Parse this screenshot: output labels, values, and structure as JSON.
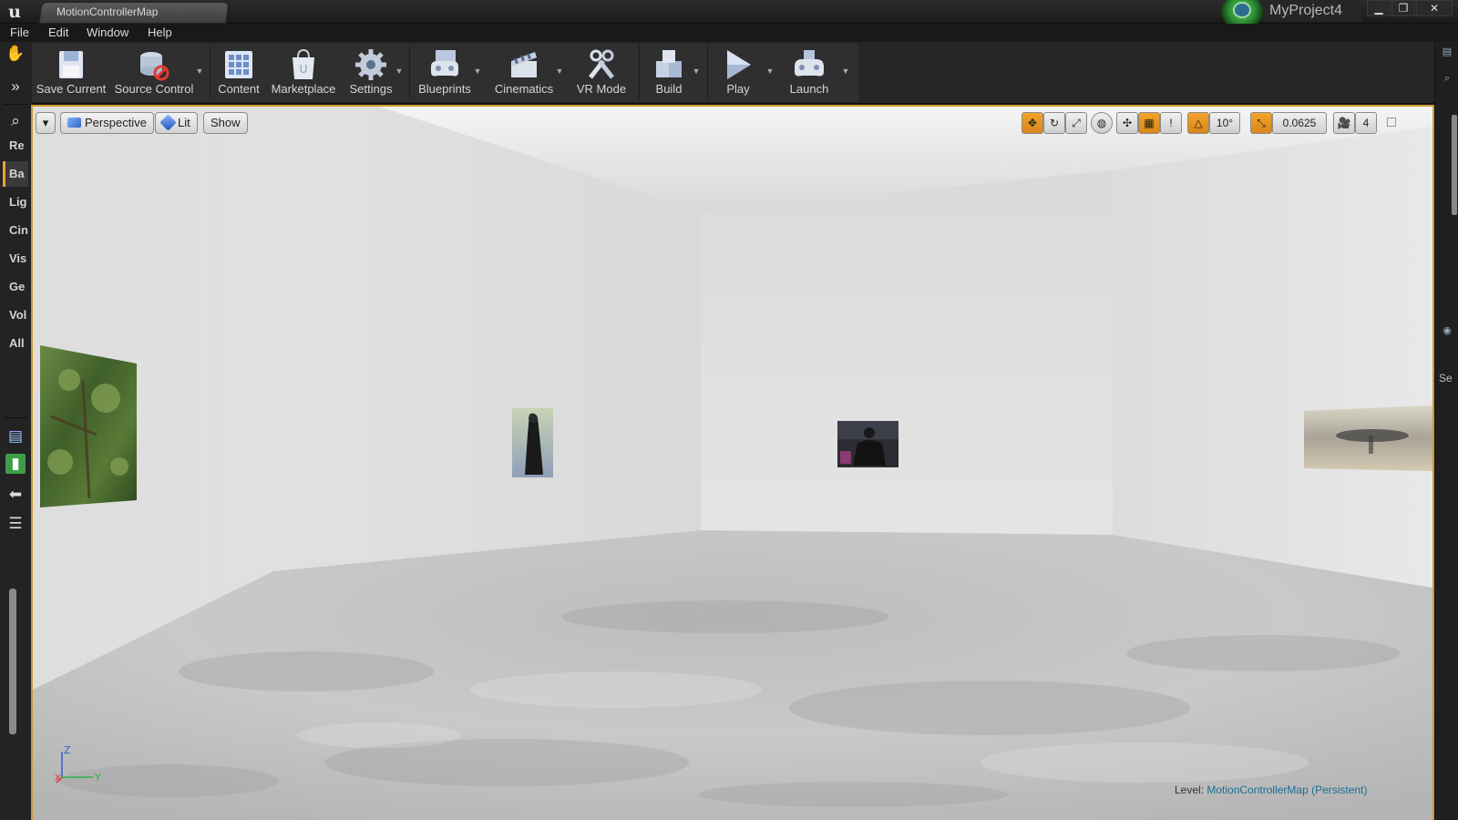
{
  "titlebar": {
    "tab_title": "MotionControllerMap",
    "project_name": "MyProject4",
    "minimize": "▁",
    "restore": "❐",
    "close": "✕"
  },
  "menu": [
    "File",
    "Edit",
    "Window",
    "Help"
  ],
  "left_panel": {
    "categories": [
      "Re",
      "Ba",
      "Lig",
      "Cin",
      "Vis",
      "Ge",
      "Vol",
      "All"
    ],
    "active_category_index": 1
  },
  "right_panel": {
    "partial_label": "Se"
  },
  "toolbar": {
    "buttons": [
      {
        "label": "Save Current",
        "icon": "save-icon",
        "glyph": "💾"
      },
      {
        "label": "Source Control",
        "icon": "source-control-icon",
        "glyph": "⛁"
      },
      {
        "label": "Content",
        "icon": "content-icon",
        "glyph": "▦"
      },
      {
        "label": "Marketplace",
        "icon": "marketplace-icon",
        "glyph": "🛍"
      },
      {
        "label": "Settings",
        "icon": "settings-icon",
        "glyph": "⚙"
      },
      {
        "label": "Blueprints",
        "icon": "blueprints-icon",
        "glyph": "🎮"
      },
      {
        "label": "Cinematics",
        "icon": "cinematics-icon",
        "glyph": "🎬"
      },
      {
        "label": "VR Mode",
        "icon": "vr-mode-icon",
        "glyph": "⚒"
      },
      {
        "label": "Build",
        "icon": "build-icon",
        "glyph": "⬛"
      },
      {
        "label": "Play",
        "icon": "play-icon",
        "glyph": "▶"
      },
      {
        "label": "Launch",
        "icon": "launch-icon",
        "glyph": "🕹"
      }
    ]
  },
  "viewport": {
    "options_arrow": "▾",
    "view_mode": "Perspective",
    "lighting": "Lit",
    "show": "Show",
    "rotation_snap": "10°",
    "scale_snap": "0.0625",
    "camera_speed": "4",
    "grid_snap_marker": "!",
    "level_label": "Level:",
    "level_value": "MotionControllerMap (Persistent)",
    "axis": {
      "z": "Z",
      "x": "X",
      "y": "Y"
    }
  },
  "colors": {
    "accent_orange": "#e89a28",
    "viewport_border": "#d09a2a",
    "level_value": "#1a6f93"
  }
}
